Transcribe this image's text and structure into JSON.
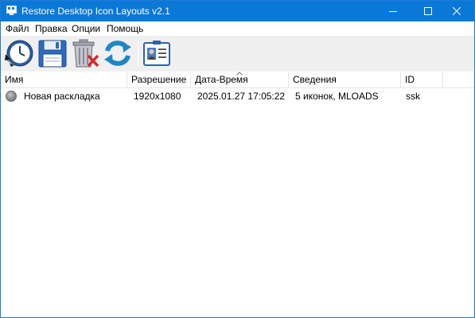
{
  "window": {
    "title": "Restore Desktop Icon Layouts v2.1",
    "accent_color": "#0a78d7",
    "controls": [
      "minimize-icon",
      "maximize-icon",
      "close-icon"
    ]
  },
  "menu": [
    "Файл",
    "Правка",
    "Опции",
    "Помощь"
  ],
  "toolbar": {
    "buttons": [
      "restore-clock-icon",
      "save-floppy-icon",
      "delete-trash-icon",
      "refresh-icon",
      "properties-card-icon"
    ]
  },
  "table": {
    "columns": [
      "Имя",
      "Разрешение",
      "Дата-Время",
      "Сведения",
      "ID"
    ],
    "sorted_column": "Дата-Время",
    "rows": [
      {
        "name": "Новая раскладка",
        "resolution": "1920x1080",
        "datetime": "2025.01.27 17:05:22",
        "details": "5 иконок, MLOADS",
        "id": "ssk",
        "status_icon": "gray-dot-icon"
      }
    ]
  }
}
